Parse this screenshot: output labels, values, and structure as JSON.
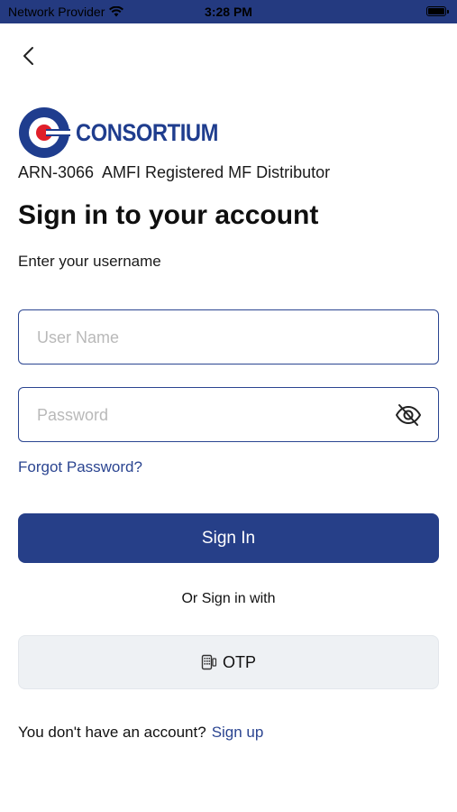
{
  "status_bar": {
    "carrier": "Network Provider",
    "time": "3:28 PM"
  },
  "brand": {
    "logo_text": "CONSORTIUM",
    "registration": "ARN-3066  AMFI Registered MF Distributor"
  },
  "page": {
    "title": "Sign in to your account",
    "subtitle": "Enter your username"
  },
  "form": {
    "username_placeholder": "User Name",
    "username_value": "",
    "password_placeholder": "Password",
    "password_value": "",
    "forgot_label": "Forgot Password?",
    "submit_label": "Sign In"
  },
  "alt_signin": {
    "separator": "Or Sign in with",
    "otp_label": "OTP"
  },
  "footer": {
    "no_account_text": "You don't have an account?",
    "signup_label": "Sign up"
  },
  "colors": {
    "primary": "#263f88",
    "link": "#2b4591",
    "logo_red": "#e01f2a",
    "otp_bg": "#eef1f4"
  }
}
